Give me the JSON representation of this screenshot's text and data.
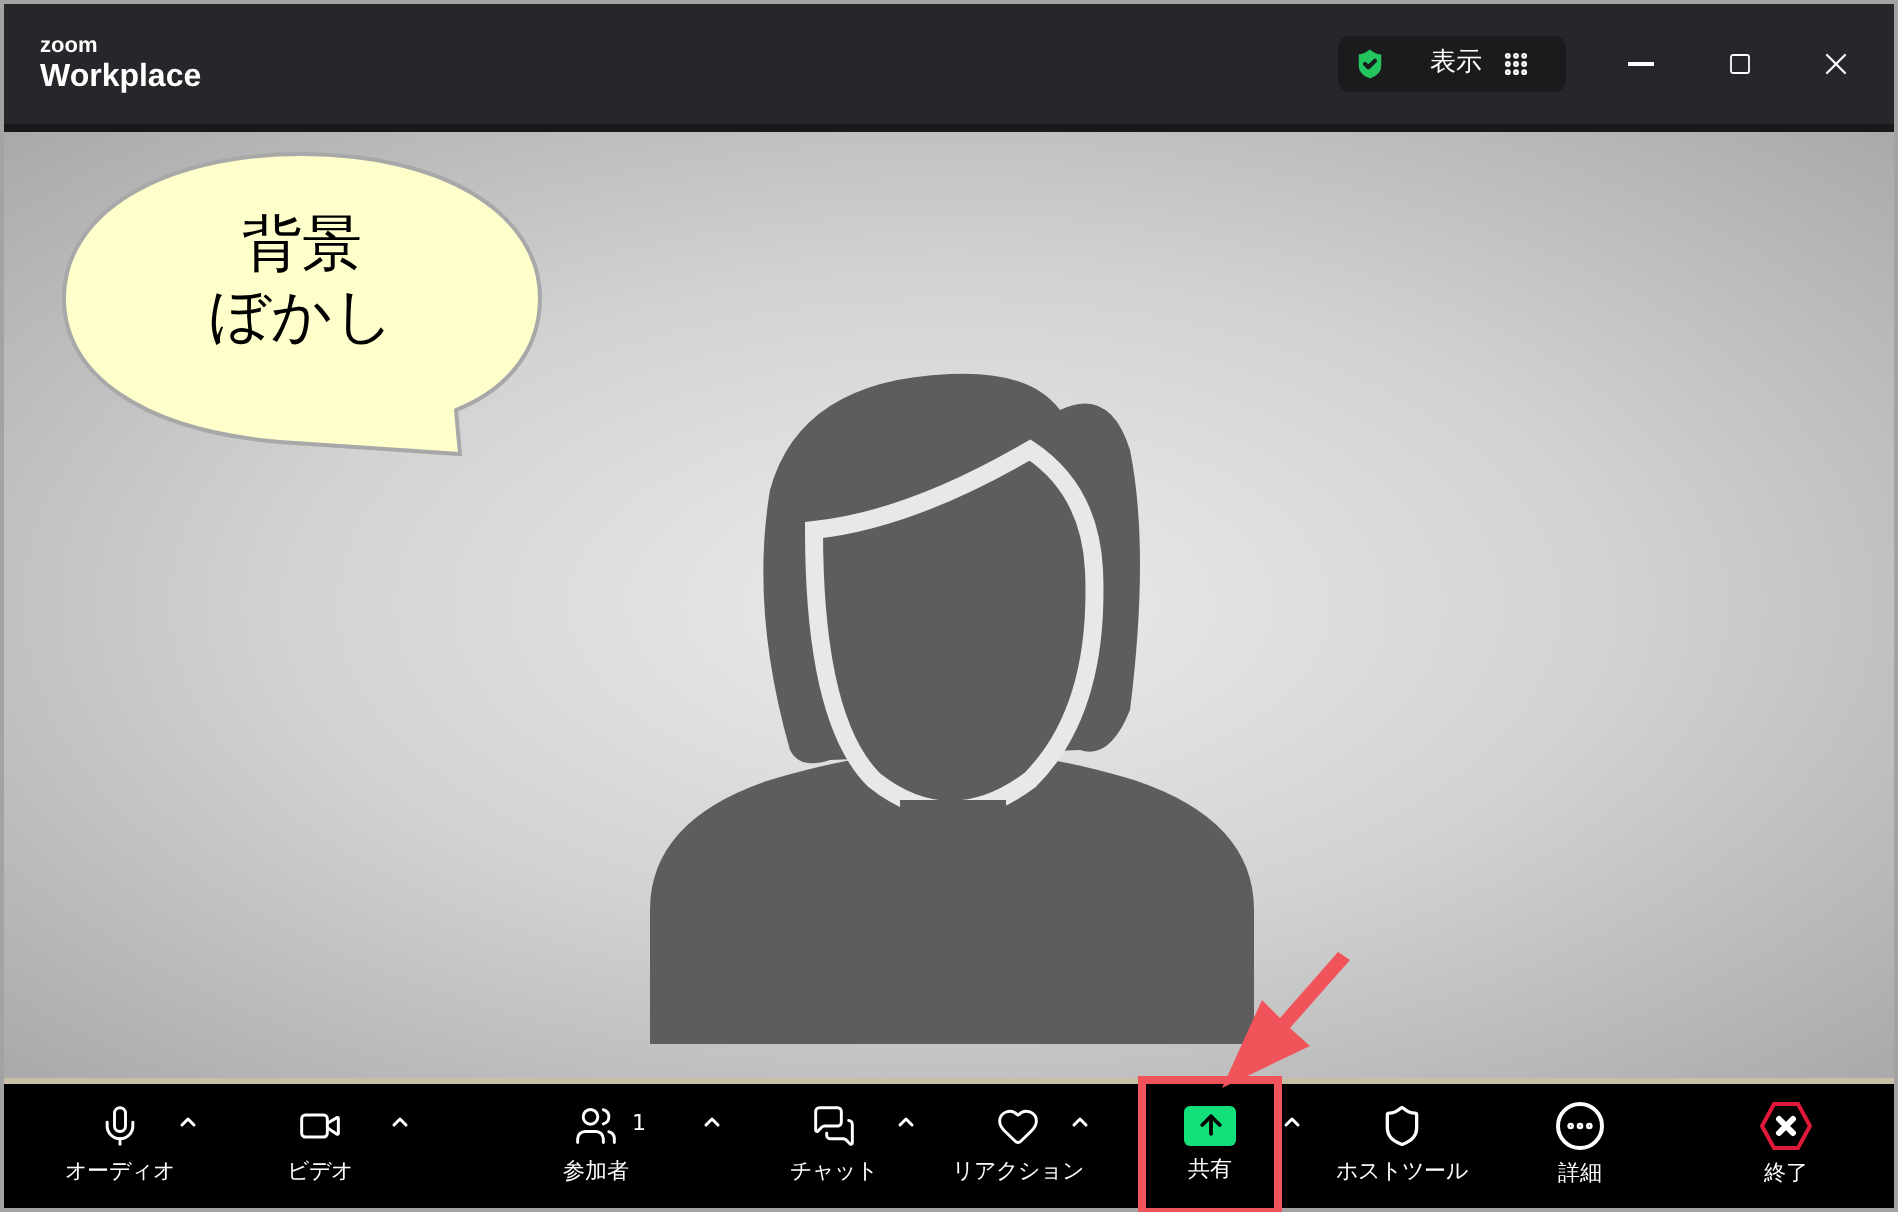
{
  "app": {
    "logo_small": "zoom",
    "logo_name": "Workplace"
  },
  "view_button": {
    "label": "表示"
  },
  "callout": {
    "lines": [
      "背景",
      "ぼかし"
    ]
  },
  "toolbar": [
    {
      "label": "オーディオ",
      "caret": true,
      "highlighted": false
    },
    {
      "label": "ビデオ",
      "caret": true,
      "highlighted": false
    },
    {
      "label": "参加者",
      "count": "1",
      "caret": true,
      "highlighted": false
    },
    {
      "label": "チャット",
      "caret": true,
      "highlighted": false
    },
    {
      "label": "リアクション",
      "caret": true,
      "highlighted": false
    },
    {
      "label": "共有",
      "caret": true,
      "highlighted": true
    },
    {
      "label": "ホストツール",
      "caret": false,
      "highlighted": false
    },
    {
      "label": "詳細",
      "caret": false,
      "highlighted": false
    },
    {
      "label": "終了",
      "caret": false,
      "highlighted": false
    }
  ]
}
